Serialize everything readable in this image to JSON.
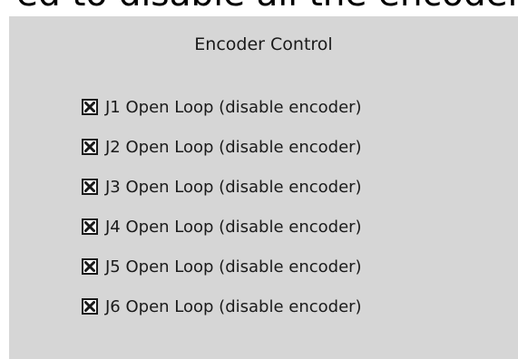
{
  "top_partial_text": "ed to disable all the encoders.",
  "panel": {
    "title": "Encoder Control",
    "items": [
      {
        "label": "J1 Open Loop (disable encoder)",
        "checked": true
      },
      {
        "label": "J2 Open Loop (disable encoder)",
        "checked": true
      },
      {
        "label": "J3 Open Loop (disable encoder)",
        "checked": true
      },
      {
        "label": "J4 Open Loop (disable encoder)",
        "checked": true
      },
      {
        "label": "J5 Open Loop (disable encoder)",
        "checked": true
      },
      {
        "label": "J6 Open Loop (disable encoder)",
        "checked": true
      }
    ]
  },
  "colors": {
    "panel_bg": "#d6d6d6",
    "text": "#1a1a1a",
    "checkbox_border": "#1a1a1a"
  },
  "icons": {
    "checkbox_mark": "x-mark-icon"
  }
}
